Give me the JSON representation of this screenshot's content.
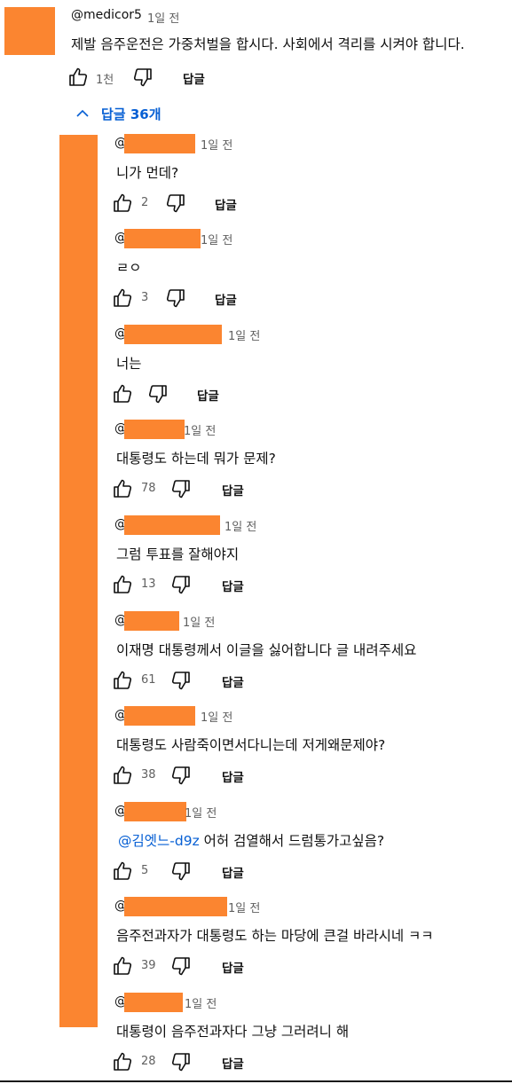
{
  "comment": {
    "author": "@medicor5",
    "time": "1일 전",
    "text": "제발 음주운전은 가중처벌을 합시다. 사회에서 격리를 시켜야 합니다.",
    "likes": "1천",
    "reply_label": "답글"
  },
  "replies_toggle": {
    "label": "답글 36개",
    "icon": "chevron-up-icon"
  },
  "replies": [
    {
      "prefix": "@",
      "time": "1일 전",
      "text": "니가 먼데?",
      "likes": "2",
      "reply_label": "답글"
    },
    {
      "prefix": "@",
      "time": "1일 전",
      "text": "ㄹㅇ",
      "likes": "3",
      "reply_label": "답글"
    },
    {
      "prefix": "@",
      "time": "1일 전",
      "text": "너는",
      "likes": "",
      "reply_label": "답글"
    },
    {
      "prefix": "@",
      "time": "1일 전",
      "text": "대통령도 하는데 뭐가 문제?",
      "likes": "78",
      "reply_label": "답글"
    },
    {
      "prefix": "@",
      "time": "1일 전",
      "text": "그럼 투표를 잘해야지",
      "likes": "13",
      "reply_label": "답글"
    },
    {
      "prefix": "@",
      "time": "1일 전",
      "text": "이재명 대통령께서 이글을 싫어합니다 글 내려주세요",
      "likes": "61",
      "reply_label": "답글"
    },
    {
      "prefix": "@",
      "time": "1일 전",
      "text": "대통령도 사람죽이면서다니는데 저게왜문제야?",
      "likes": "38",
      "reply_label": "답글"
    },
    {
      "prefix": "@",
      "time": "1일 전",
      "mention": "@김엣느-d9z",
      "text": " 어허 검열해서 드럼통가고싶음?",
      "likes": "5",
      "reply_label": "답글"
    },
    {
      "prefix": "@",
      "time": "1일 전",
      "text": "음주전과자가 대통령도 하는 마당에 큰걸 바라시네 ㅋㅋ",
      "likes": "39",
      "reply_label": "답글"
    },
    {
      "prefix": "@",
      "time": "1일 전",
      "text": "대통령이 음주전과자다 그냥 그러려니 해",
      "likes": "28",
      "reply_label": "답글"
    }
  ],
  "colors": {
    "redaction": "#fb8530",
    "link": "#065fd4",
    "meta": "#606060"
  }
}
